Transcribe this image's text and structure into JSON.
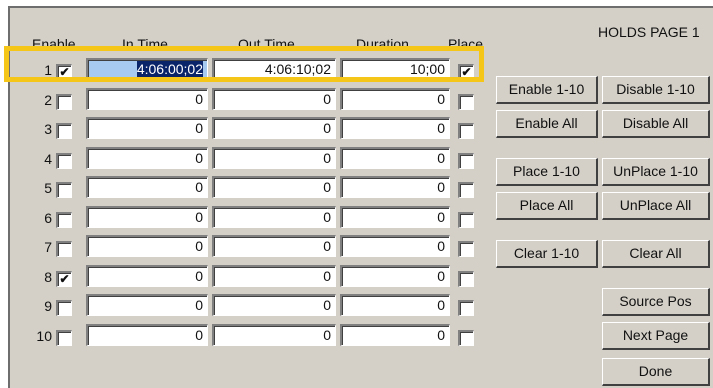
{
  "page_title": "HOLDS PAGE 1",
  "headers": {
    "enable": "Enable",
    "in_time": "In Time",
    "out_time": "Out Time",
    "duration": "Duration",
    "place": "Place"
  },
  "rows": [
    {
      "num": "1",
      "enabled": true,
      "in_time": "4:06:00;02",
      "out_time": "4:06:10;02",
      "duration": "10;00",
      "placed": true
    },
    {
      "num": "2",
      "enabled": false,
      "in_time": "0",
      "out_time": "0",
      "duration": "0",
      "placed": false
    },
    {
      "num": "3",
      "enabled": false,
      "in_time": "0",
      "out_time": "0",
      "duration": "0",
      "placed": false
    },
    {
      "num": "4",
      "enabled": false,
      "in_time": "0",
      "out_time": "0",
      "duration": "0",
      "placed": false
    },
    {
      "num": "5",
      "enabled": false,
      "in_time": "0",
      "out_time": "0",
      "duration": "0",
      "placed": false
    },
    {
      "num": "6",
      "enabled": false,
      "in_time": "0",
      "out_time": "0",
      "duration": "0",
      "placed": false
    },
    {
      "num": "7",
      "enabled": false,
      "in_time": "0",
      "out_time": "0",
      "duration": "0",
      "placed": false
    },
    {
      "num": "8",
      "enabled": true,
      "in_time": "0",
      "out_time": "0",
      "duration": "0",
      "placed": false
    },
    {
      "num": "9",
      "enabled": false,
      "in_time": "0",
      "out_time": "0",
      "duration": "0",
      "placed": false
    },
    {
      "num": "10",
      "enabled": false,
      "in_time": "0",
      "out_time": "0",
      "duration": "0",
      "placed": false
    }
  ],
  "buttons": {
    "enable_1_10": "Enable 1-10",
    "disable_1_10": "Disable 1-10",
    "enable_all": "Enable All",
    "disable_all": "Disable All",
    "place_1_10": "Place 1-10",
    "unplace_1_10": "UnPlace 1-10",
    "place_all": "Place All",
    "unplace_all": "UnPlace All",
    "clear_1_10": "Clear 1-10",
    "clear_all": "Clear All",
    "source_pos": "Source Pos",
    "next_page": "Next Page",
    "done": "Done"
  },
  "check_glyph": "✔",
  "colors": {
    "panel": "#d4d0c8",
    "highlight": "#f5c518",
    "selection": "#0a246a"
  }
}
